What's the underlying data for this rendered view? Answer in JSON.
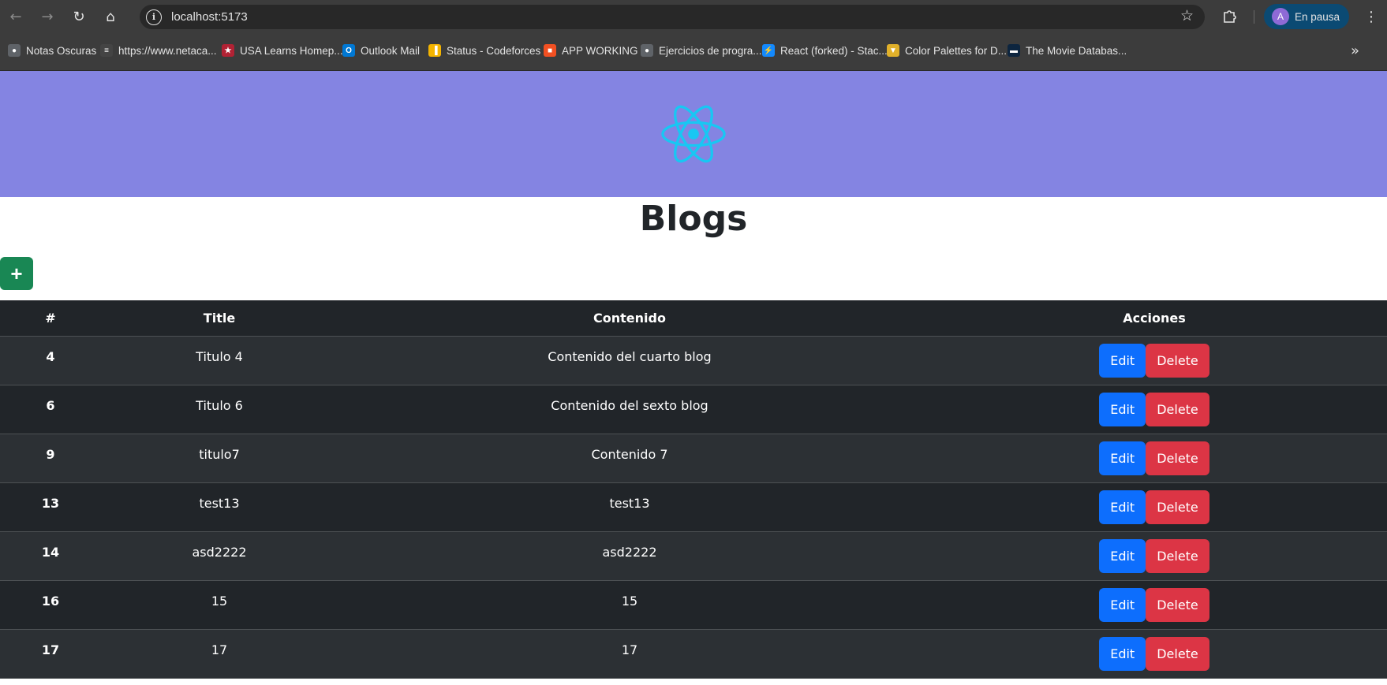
{
  "browser": {
    "url": "localhost:5173",
    "profile_initial": "A",
    "profile_label": "En pausa",
    "bookmarks": [
      {
        "label": "Notas Oscuras",
        "icon": "globe-icon",
        "color": "#5f6368"
      },
      {
        "label": "https://www.netaca...",
        "icon": "netacad-icon",
        "color": "#444444"
      },
      {
        "label": "USA Learns Homep...",
        "icon": "star-flag-icon",
        "color": "#b22234"
      },
      {
        "label": "Outlook Mail",
        "icon": "outlook-icon",
        "color": "#0078d4"
      },
      {
        "label": "Status - Codeforces",
        "icon": "codeforces-icon",
        "color": "#f4b400"
      },
      {
        "label": "APP WORKING",
        "icon": "microsoft-icon",
        "color": "#f25022"
      },
      {
        "label": "Ejercicios de progra...",
        "icon": "globe-icon",
        "color": "#5f6368"
      },
      {
        "label": "React (forked) - Stac...",
        "icon": "bolt-icon",
        "color": "#1389fd"
      },
      {
        "label": "Color Palettes for D...",
        "icon": "palette-icon",
        "color": "#e0b02a"
      },
      {
        "label": "The Movie Databas...",
        "icon": "tmdb-icon",
        "color": "#0d253f"
      }
    ]
  },
  "page": {
    "title": "Blogs",
    "add_label": "+",
    "hero_color": "#8484e2",
    "logo_color": "#18c7f3"
  },
  "table": {
    "headers": {
      "id": "#",
      "title": "Title",
      "content": "Contenido",
      "actions": "Acciones"
    },
    "edit_label": "Edit",
    "delete_label": "Delete",
    "rows": [
      {
        "id": "4",
        "title": "Titulo 4",
        "content": "Contenido del cuarto blog"
      },
      {
        "id": "6",
        "title": "Titulo 6",
        "content": "Contenido del sexto blog"
      },
      {
        "id": "9",
        "title": "titulo7",
        "content": "Contenido 7"
      },
      {
        "id": "13",
        "title": "test13",
        "content": "test13"
      },
      {
        "id": "14",
        "title": "asd2222",
        "content": "asd2222"
      },
      {
        "id": "16",
        "title": "15",
        "content": "15"
      },
      {
        "id": "17",
        "title": "17",
        "content": "17"
      }
    ]
  }
}
